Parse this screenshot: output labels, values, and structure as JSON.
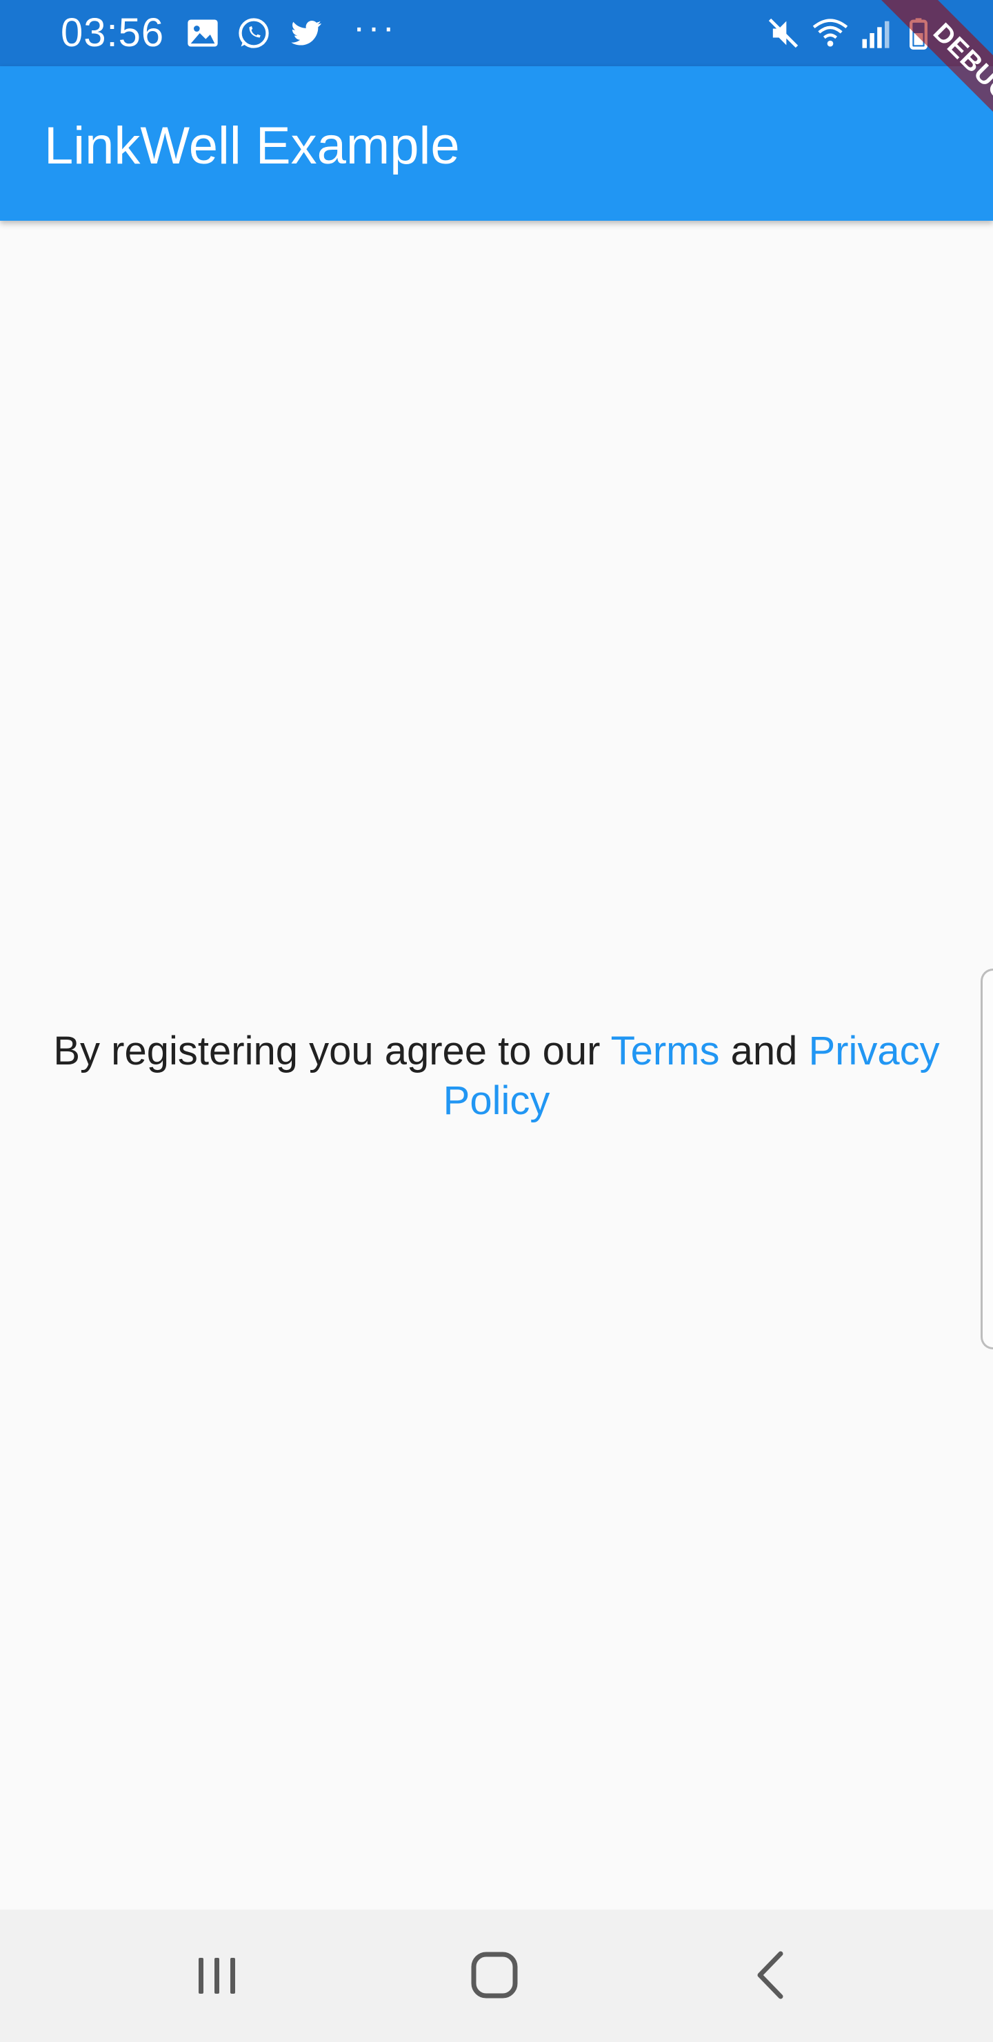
{
  "status_bar": {
    "time": "03:56",
    "left_icons": [
      "image-icon",
      "whatsapp-icon",
      "twitter-icon"
    ],
    "more_indicator": "···",
    "right_icons": [
      "mute-icon",
      "wifi-icon",
      "signal-icon",
      "battery-icon"
    ],
    "background_color": "#1976d2"
  },
  "app_bar": {
    "title": "LinkWell Example",
    "background_color": "#2196f3"
  },
  "debug_banner": {
    "label": "DEBUG"
  },
  "content": {
    "text_before": "By registering you agree to our ",
    "link_terms": "Terms",
    "text_middle": " and ",
    "link_privacy": "Privacy Policy",
    "link_color": "#2196f3"
  },
  "nav_bar": {
    "buttons": [
      "recents-icon",
      "home-icon",
      "back-icon"
    ]
  }
}
